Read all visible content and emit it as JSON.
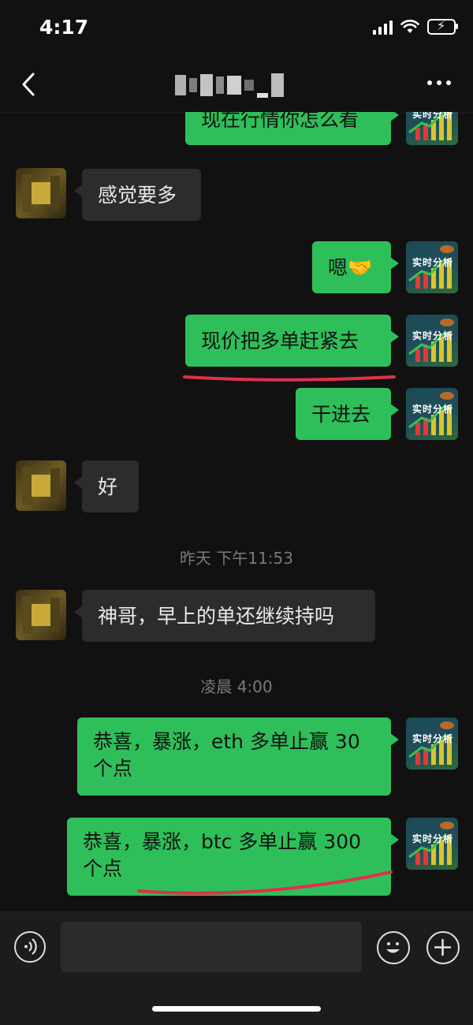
{
  "status_bar": {
    "time": "4:17"
  },
  "nav": {
    "title_obscured": true
  },
  "messages": [
    {
      "side": "out",
      "text": "现在行情你怎么看"
    },
    {
      "side": "in",
      "text": "感觉要多"
    },
    {
      "side": "out",
      "text": "嗯🤝"
    },
    {
      "side": "out",
      "text": "现价把多单赶紧去",
      "underlined": true
    },
    {
      "side": "out",
      "text": "干进去"
    },
    {
      "side": "in",
      "text": "好"
    },
    {
      "side": "in",
      "text": "神哥，早上的单还继续持吗"
    },
    {
      "side": "out",
      "text": "恭喜，暴涨，eth 多单止赢 30 个点"
    },
    {
      "side": "out",
      "text": "恭喜，暴涨，btc 多单止赢 300 个点",
      "underlined": true
    }
  ],
  "timestamps": [
    "昨天 下午11:53",
    "凌晨 4:00"
  ],
  "avatar_brand": "实时分析",
  "colors": {
    "outgoing_bubble": "#2fbf5a",
    "incoming_bubble": "#2c2c2c",
    "background": "#111111",
    "annotation": "#e0304a"
  },
  "input_bar": {
    "placeholder": ""
  }
}
